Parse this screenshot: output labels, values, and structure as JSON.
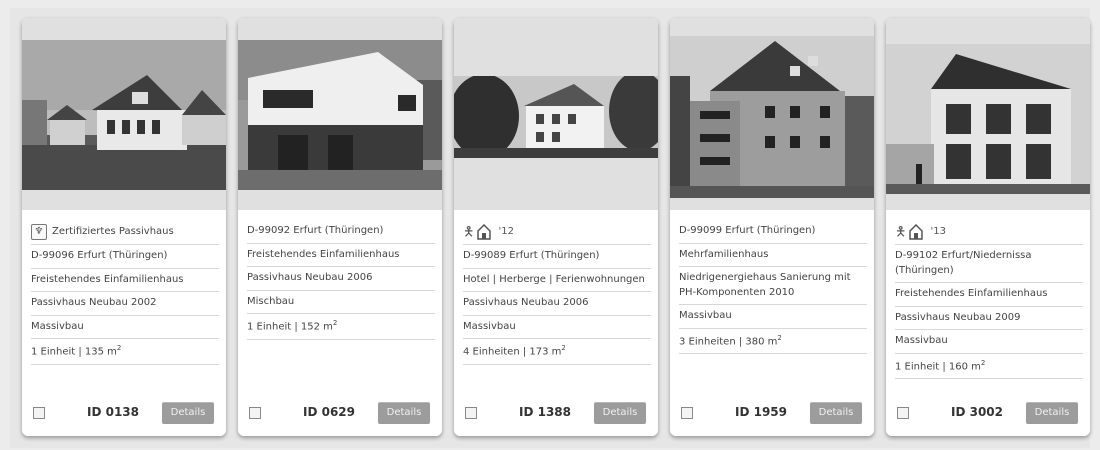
{
  "cards": [
    {
      "rows": [
        "D-99096 Erfurt (Thüringen)",
        "Freistehendes Einfamilienhaus",
        "Passivhaus Neubau 2002",
        "Massivbau"
      ],
      "badge": {
        "type": "certified",
        "label": "Zertifiziertes Passivhaus"
      },
      "units": "1 Einheit | 135 m",
      "units_sup": "2",
      "id": "ID 0138",
      "details": "Details"
    },
    {
      "rows": [
        "D-99092 Erfurt (Thüringen)",
        "Freistehendes Einfamilienhaus",
        "Passivhaus Neubau 2006",
        "Mischbau"
      ],
      "badge": null,
      "units": "1 Einheit | 152 m",
      "units_sup": "2",
      "id": "ID 0629",
      "details": "Details"
    },
    {
      "rows": [
        "D-99089 Erfurt (Thüringen)",
        "Hotel | Herberge | Ferienwohnungen",
        "Passivhaus Neubau 2006",
        "Massivbau"
      ],
      "badge": {
        "type": "award",
        "label": "'12"
      },
      "units": "4 Einheiten | 173 m",
      "units_sup": "2",
      "id": "ID 1388",
      "details": "Details"
    },
    {
      "rows": [
        "D-99099 Erfurt (Thüringen)",
        "Mehrfamilienhaus",
        "Niedrigenergiehaus Sanierung mit PH-Komponenten 2010",
        "Massivbau"
      ],
      "badge": null,
      "units": "3 Einheiten | 380 m",
      "units_sup": "2",
      "id": "ID 1959",
      "details": "Details"
    },
    {
      "rows": [
        "D-99102 Erfurt/Niedernissa (Thüringen)",
        "Freistehendes Einfamilienhaus",
        "Passivhaus Neubau 2009",
        "Massivbau"
      ],
      "badge": {
        "type": "award",
        "label": "'13"
      },
      "units": "1 Einheit | 160 m",
      "units_sup": "2",
      "id": "ID 3002",
      "details": "Details"
    }
  ],
  "icons": {
    "certified": "leaf-certificate-icon",
    "award": "person-house-award-icon",
    "checkbox": "compare-checkbox"
  }
}
